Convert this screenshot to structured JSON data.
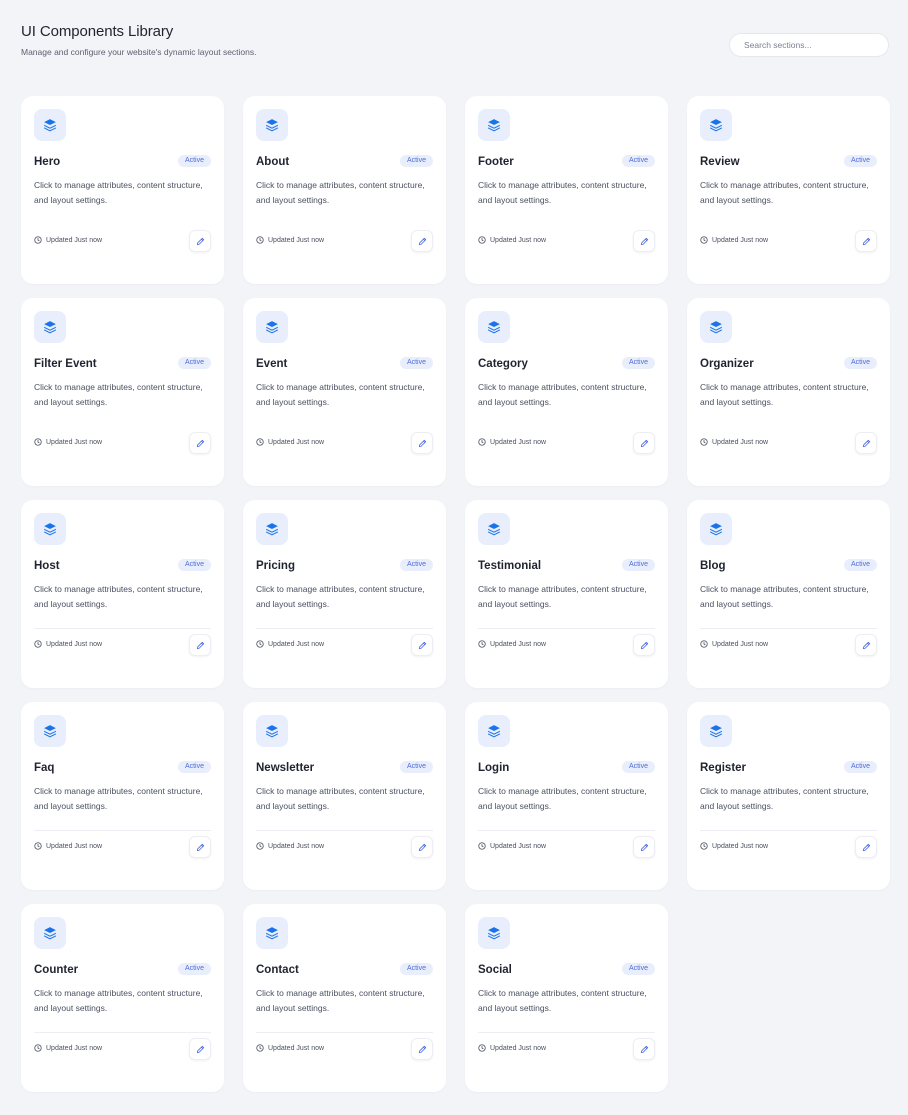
{
  "header": {
    "title": "UI Components Library",
    "subtitle": "Manage and configure your website's dynamic layout sections."
  },
  "search": {
    "placeholder": "Search sections..."
  },
  "colors": {
    "background": "#f3f4f8",
    "card": "#ffffff",
    "accent": "#1a73e8",
    "icon_bg": "#e8eefc",
    "badge_text": "#4f6bd8"
  },
  "cards": [
    {
      "title": "Hero",
      "badge": "Active",
      "description": "Click to manage attributes, content structure, and layout settings.",
      "updated": "Updated Just now",
      "icon": "layers-icon",
      "divider": false
    },
    {
      "title": "About",
      "badge": "Active",
      "description": "Click to manage attributes, content structure, and layout settings.",
      "updated": "Updated Just now",
      "icon": "layers-icon",
      "divider": false
    },
    {
      "title": "Footer",
      "badge": "Active",
      "description": "Click to manage attributes, content structure, and layout settings.",
      "updated": "Updated Just now",
      "icon": "layers-icon",
      "divider": false
    },
    {
      "title": "Review",
      "badge": "Active",
      "description": "Click to manage attributes, content structure, and layout settings.",
      "updated": "Updated Just now",
      "icon": "layers-icon",
      "divider": false
    },
    {
      "title": "Filter Event",
      "badge": "Active",
      "description": "Click to manage attributes, content structure, and layout settings.",
      "updated": "Updated Just now",
      "icon": "layers-icon",
      "divider": false
    },
    {
      "title": "Event",
      "badge": "Active",
      "description": "Click to manage attributes, content structure, and layout settings.",
      "updated": "Updated Just now",
      "icon": "layers-icon",
      "divider": false
    },
    {
      "title": "Category",
      "badge": "Active",
      "description": "Click to manage attributes, content structure, and layout settings.",
      "updated": "Updated Just now",
      "icon": "layers-icon",
      "divider": false
    },
    {
      "title": "Organizer",
      "badge": "Active",
      "description": "Click to manage attributes, content structure, and layout settings.",
      "updated": "Updated Just now",
      "icon": "layers-icon",
      "divider": false
    },
    {
      "title": "Host",
      "badge": "Active",
      "description": "Click to manage attributes, content structure, and layout settings.",
      "updated": "Updated Just now",
      "icon": "layers-icon",
      "divider": true
    },
    {
      "title": "Pricing",
      "badge": "Active",
      "description": "Click to manage attributes, content structure, and layout settings.",
      "updated": "Updated Just now",
      "icon": "layers-icon",
      "divider": true
    },
    {
      "title": "Testimonial",
      "badge": "Active",
      "description": "Click to manage attributes, content structure, and layout settings.",
      "updated": "Updated Just now",
      "icon": "layers-icon",
      "divider": true
    },
    {
      "title": "Blog",
      "badge": "Active",
      "description": "Click to manage attributes, content structure, and layout settings.",
      "updated": "Updated Just now",
      "icon": "layers-icon",
      "divider": true
    },
    {
      "title": "Faq",
      "badge": "Active",
      "description": "Click to manage attributes, content structure, and layout settings.",
      "updated": "Updated Just now",
      "icon": "layers-icon",
      "divider": true
    },
    {
      "title": "Newsletter",
      "badge": "Active",
      "description": "Click to manage attributes, content structure, and layout settings.",
      "updated": "Updated Just now",
      "icon": "layers-icon",
      "divider": true
    },
    {
      "title": "Login",
      "badge": "Active",
      "description": "Click to manage attributes, content structure, and layout settings.",
      "updated": "Updated Just now",
      "icon": "layers-icon",
      "divider": true
    },
    {
      "title": "Register",
      "badge": "Active",
      "description": "Click to manage attributes, content structure, and layout settings.",
      "updated": "Updated Just now",
      "icon": "layers-icon",
      "divider": true
    },
    {
      "title": "Counter",
      "badge": "Active",
      "description": "Click to manage attributes, content structure, and layout settings.",
      "updated": "Updated Just now",
      "icon": "layers-icon",
      "divider": true
    },
    {
      "title": "Contact",
      "badge": "Active",
      "description": "Click to manage attributes, content structure, and layout settings.",
      "updated": "Updated Just now",
      "icon": "layers-icon",
      "divider": true
    },
    {
      "title": "Social",
      "badge": "Active",
      "description": "Click to manage attributes, content structure, and layout settings.",
      "updated": "Updated Just now",
      "icon": "layers-icon",
      "divider": true
    }
  ]
}
